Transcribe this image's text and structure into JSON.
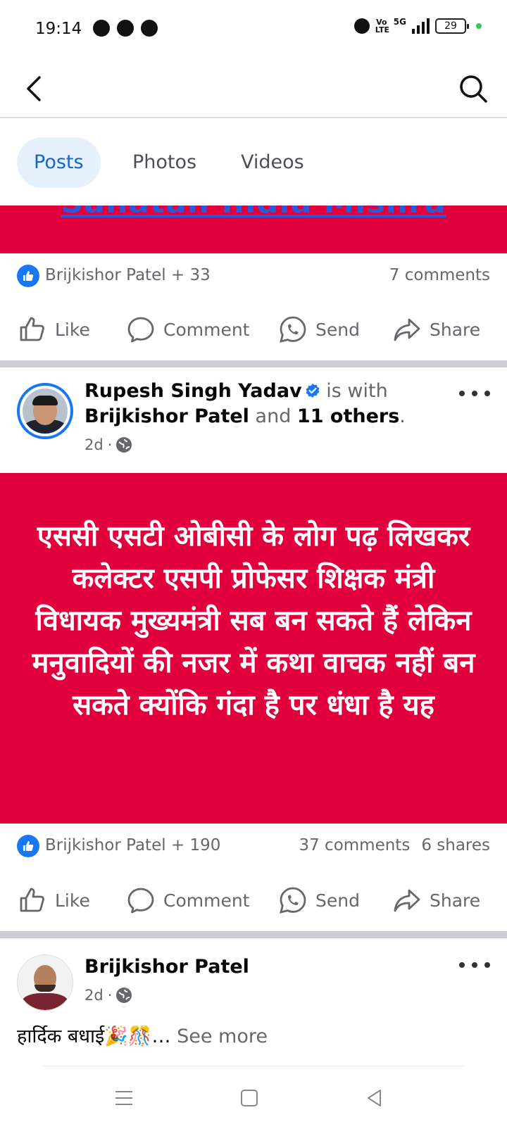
{
  "status_bar": {
    "time": "19:14",
    "network": "5G",
    "volte": "Vo LTE",
    "battery": "29"
  },
  "tabs": [
    {
      "label": "Posts",
      "active": true
    },
    {
      "label": "Photos",
      "active": false
    },
    {
      "label": "Videos",
      "active": false
    }
  ],
  "post1": {
    "banner_text_cutoff": "Sanatan India Mishra",
    "banner_color": "#e1003c",
    "reactions": "Brijkishor Patel + 33",
    "comments": "7 comments"
  },
  "actions": {
    "like": "Like",
    "comment": "Comment",
    "send": "Send",
    "share": "Share"
  },
  "post2": {
    "author": "Rupesh Singh Yadav",
    "with_text": "is with",
    "tagged": "Brijkishor Patel",
    "and_text": "and",
    "others": "11 others",
    "period": ".",
    "time": "2d",
    "separator": "·",
    "banner_text": "एससी एसटी ओबीसी के लोग पढ़ लिखकर कलेक्टर एसपी प्रोफेसर शिक्षक मंत्री विधायक मुख्यमंत्री सब बन सकते हैं लेकिन मनुवादियों की नजर में कथा वाचक नहीं बन सकते क्योंकि गंदा है पर धंधा है यह",
    "banner_color": "#e1003c",
    "reactions": "Brijkishor Patel + 190",
    "comments": "37 comments",
    "shares": "6 shares"
  },
  "post3": {
    "author": "Brijkishor Patel",
    "time": "2d",
    "separator": "·",
    "caption": "हार्दिक बधाई🎉🎊…",
    "see_more": "See more"
  },
  "colors": {
    "accent": "#1877f2",
    "tab_active_bg": "#e7f0fd",
    "tab_active_text": "#1267c8",
    "muted": "#65676b"
  },
  "icons": [
    "back-arrow-icon",
    "search-icon",
    "like-icon",
    "comment-icon",
    "send-icon",
    "share-icon",
    "verified-icon",
    "globe-icon",
    "more-icon",
    "menu-icon",
    "home-icon",
    "back-triangle-icon"
  ]
}
